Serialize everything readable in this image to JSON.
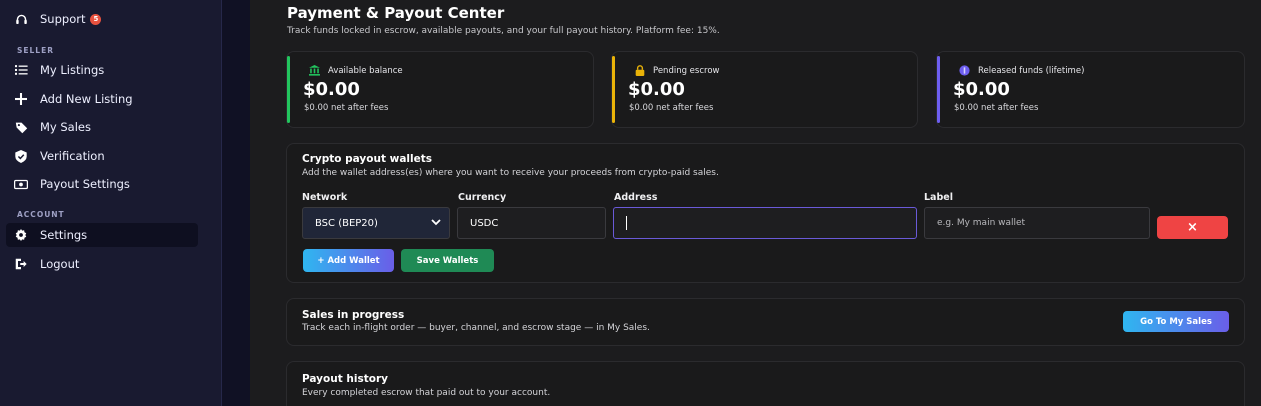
{
  "sidebar": {
    "support": {
      "label": "Support",
      "badge": "5"
    },
    "seller_section": "SELLER",
    "seller_items": [
      {
        "label": "My Listings",
        "icon": "list-icon"
      },
      {
        "label": "Add New Listing",
        "icon": "plus-icon"
      },
      {
        "label": "My Sales",
        "icon": "tag-icon"
      },
      {
        "label": "Verification",
        "icon": "shield-check-icon"
      },
      {
        "label": "Payout Settings",
        "icon": "money-icon"
      }
    ],
    "account_section": "ACCOUNT",
    "account_items": [
      {
        "label": "Settings",
        "icon": "gear-icon",
        "active": true
      },
      {
        "label": "Logout",
        "icon": "logout-icon"
      }
    ]
  },
  "header": {
    "title": "Payment & Payout Center",
    "subtitle": "Track funds locked in escrow, available payouts, and your full payout history. Platform fee: 15%."
  },
  "stats": [
    {
      "label": "Available balance",
      "value": "$0.00",
      "net": "$0.00 net after fees",
      "accent": "#22c55e",
      "icon": "bank-icon"
    },
    {
      "label": "Pending escrow",
      "value": "$0.00",
      "net": "$0.00 net after fees",
      "accent": "#eab308",
      "icon": "lock-icon"
    },
    {
      "label": "Released funds (lifetime)",
      "value": "$0.00",
      "net": "$0.00 net after fees",
      "accent": "#6d5ef0",
      "icon": "coin-icon"
    }
  ],
  "wallets": {
    "title": "Crypto payout wallets",
    "subtitle": "Add the wallet address(es) where you want to receive your proceeds from crypto-paid sales.",
    "labels": {
      "network": "Network",
      "currency": "Currency",
      "address": "Address",
      "label": "Label"
    },
    "network_value": "BSC (BEP20)",
    "currency_value": "USDC",
    "address_value": "",
    "label_placeholder": "e.g. My main wallet",
    "remove_label": "×",
    "add_label": "+ Add Wallet",
    "save_label": "Save Wallets"
  },
  "sales": {
    "title": "Sales in progress",
    "subtitle": "Track each in-flight order — buyer, channel, and escrow stage — in My Sales.",
    "button": "Go To My Sales"
  },
  "history": {
    "title": "Payout history",
    "subtitle": "Every completed escrow that paid out to your account."
  }
}
